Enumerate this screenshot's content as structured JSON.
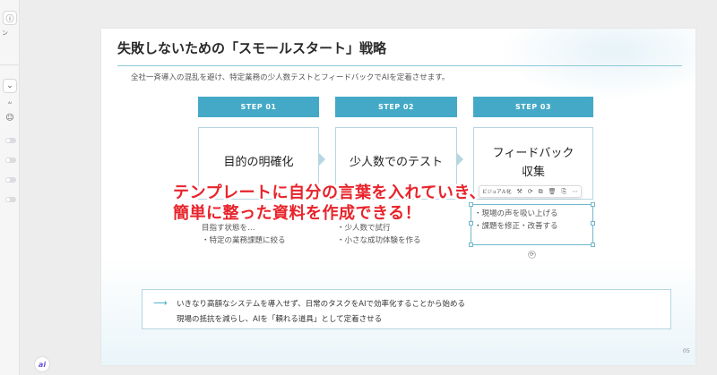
{
  "left_panel": {
    "info_icon": "ⓘ",
    "text_fragment": "ン",
    "dropdown_chevron": "⌄",
    "sparkle_icon": "ᴬᴵ",
    "emoji_icon": "☺"
  },
  "ai_avatar_label": "ai",
  "slide": {
    "title": "失敗しないための「スモールスタート」戦略",
    "subtitle": "全社一斉導入の混乱を避け、特定業務の少人数テストとフィードバックでAIを定着させます。",
    "steps": [
      {
        "header": "STEP 01",
        "title": "目的の明確化",
        "bullets": [
          "目指す状態を…",
          "・特定の業務課題に絞る"
        ]
      },
      {
        "header": "STEP 02",
        "title": "少人数でのテスト",
        "bullets": [
          "・少人数で試行",
          "・小さな成功体験を作る"
        ]
      },
      {
        "header": "STEP 03",
        "title_line1": "フィードバック",
        "title_line2": "収集",
        "bullets": [
          "・現場の声を吸い上げる",
          "・課題を修正・改善する"
        ]
      }
    ],
    "note": {
      "arrow": "⟶",
      "line1": "いきなり高額なシステムを導入せず、日常のタスクをAIで効率化することから始める",
      "line2": "現場の抵抗を減らし、AIを「頼れる道具」として定着させる"
    },
    "page_number": "05"
  },
  "toolbar": {
    "label": "ビジュアル化",
    "icons": [
      "⚒",
      "⟳",
      "⧉",
      "🗑",
      "⎘",
      "⋯"
    ]
  },
  "overlay": {
    "line1": "テンプレートに自分の言葉を入れていき、",
    "line2": "簡単に整った資料を作成できる！"
  },
  "colors": {
    "accent": "#44a9c7",
    "overlay_red": "#e8232b",
    "border": "#b6d6e2"
  }
}
